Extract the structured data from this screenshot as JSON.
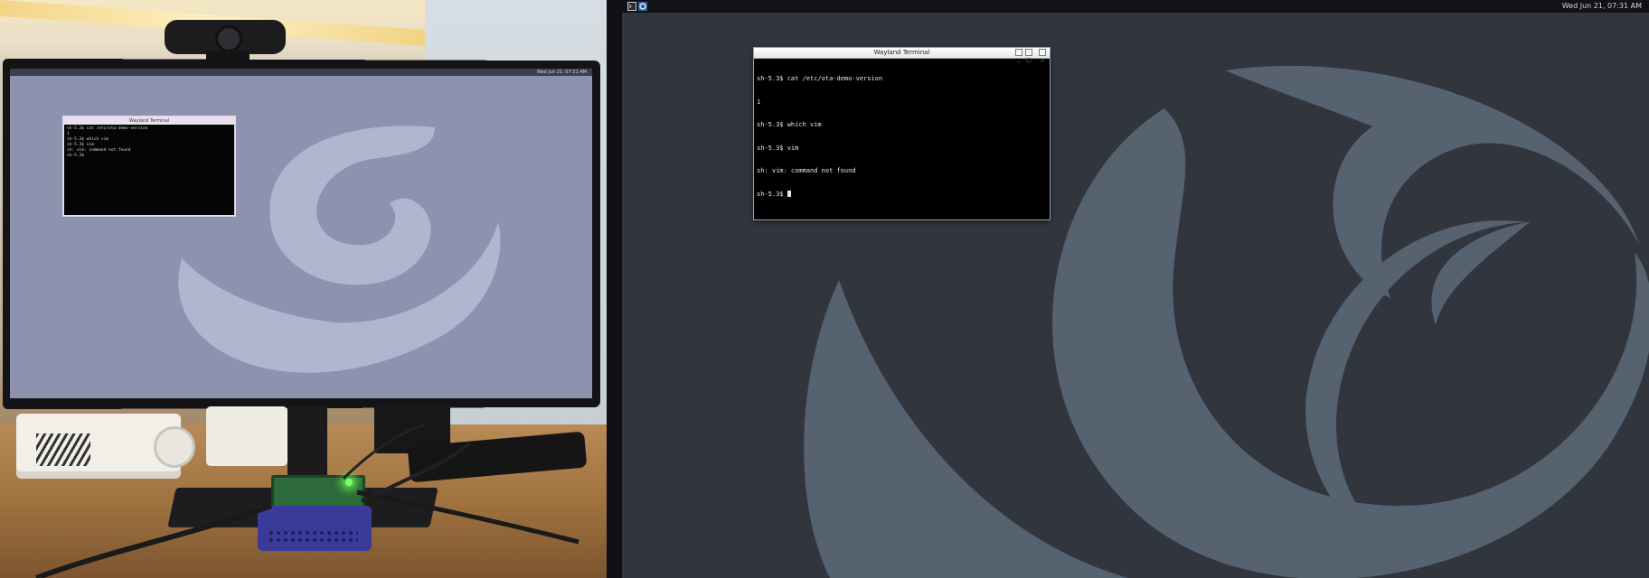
{
  "desktop": {
    "panel": {
      "left_icons": [
        "terminal-icon",
        "app-launcher-icon"
      ],
      "clock": "Wed Jun 21, 07:31 AM"
    },
    "terminal": {
      "title": "Wayland Terminal",
      "lines": [
        "sh-5.3$ cat /etc/ota-demo-version",
        "1",
        "sh-5.3$ which vim",
        "sh-5.3$ vim",
        "sh: vim: command not found",
        "sh-5.3$ "
      ],
      "buttons": [
        "minimize",
        "maximize",
        "close"
      ]
    }
  },
  "colors": {
    "desktop_bg": "#30353e",
    "wallpaper_logo": "#566270",
    "panel_bg": "#111215",
    "terminal_bg": "#000000"
  }
}
